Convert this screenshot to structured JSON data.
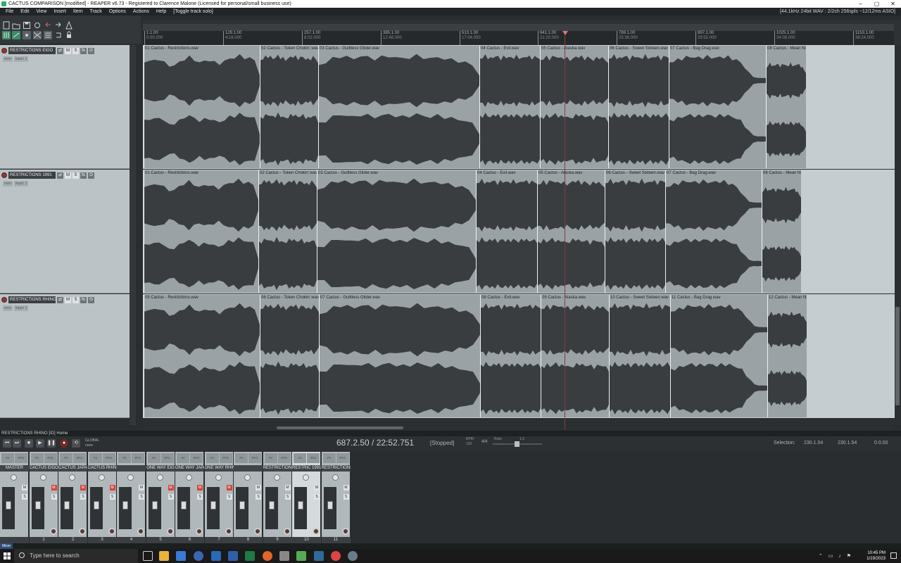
{
  "title_bar": {
    "text": "CACTUS COMPARISON [modified] - REAPER v6.73 - Registered to Clarence Malone (Licensed for personal/small business use)"
  },
  "menu": {
    "items": [
      "File",
      "Edit",
      "View",
      "Insert",
      "Item",
      "Track",
      "Options",
      "Actions",
      "Help",
      "[Toggle track solo]"
    ],
    "status": "[44.1kHz 24bit WAV : 2/2ch 256spls ~12/12ms ASIO]"
  },
  "ruler": {
    "ticks": [
      {
        "bar": "1.1.00",
        "time": "0:00.000"
      },
      {
        "bar": "129.1.00",
        "time": "4:16.000"
      },
      {
        "bar": "257.1.00",
        "time": "8:32.000"
      },
      {
        "bar": "385.1.00",
        "time": "12:48.000"
      },
      {
        "bar": "513.1.00",
        "time": "17:04.000"
      },
      {
        "bar": "641.1.00",
        "time": "21:20.000"
      },
      {
        "bar": "769.1.00",
        "time": "25:36.000"
      },
      {
        "bar": "897.1.00",
        "time": "29:52.000"
      },
      {
        "bar": "1025.1.00",
        "time": "34:08.000"
      },
      {
        "bar": "1153.1.00",
        "time": "38:24.000"
      }
    ]
  },
  "tracks": [
    {
      "name": "RESTRICTIONS EIGO",
      "num": "9",
      "input": "Input: 1",
      "items": [
        {
          "label": "01 Cactus - Restrictions.wav"
        },
        {
          "label": "02 Cactus - Token Chokin'.wav"
        },
        {
          "label": "03 Cactus - Guiltless Glider.wav"
        },
        {
          "label": "04 Cactus - Evil.wav"
        },
        {
          "label": "05 Cactus - Alaska.wav"
        },
        {
          "label": "06 Cactus - Sweet Sixteen.wav"
        },
        {
          "label": "07 Cactus - Bag Drag.wav"
        },
        {
          "label": "08 Cactus - Mean Night..."
        }
      ]
    },
    {
      "name": "RESTRICTIONS 1991",
      "num": "10",
      "input": "Input: 1",
      "items": [
        {
          "label": "01 Cactus - Restrictions.wav"
        },
        {
          "label": "02 Cactus - Token Chokin'.wav"
        },
        {
          "label": "03 Cactus - Guiltless Glider.wav"
        },
        {
          "label": "04 Cactus - Evil.wav"
        },
        {
          "label": "05 Cactus - Alaska.wav"
        },
        {
          "label": "06 Cactus - Sweet Sixteen.wav"
        },
        {
          "label": "07 Cactus - Bag Drag.wav"
        },
        {
          "label": "08 Cactus - Mean Nig..."
        }
      ]
    },
    {
      "name": "RESTRICTIONS RHINO",
      "num": "11",
      "input": "Input: 1",
      "items": [
        {
          "label": "05 Cactus - Restrictions.wav"
        },
        {
          "label": "06 Cactus - Token Chokin'.wav"
        },
        {
          "label": "07 Cactus - Guiltless Glider.wav"
        },
        {
          "label": "08 Cactus - Evil.wav"
        },
        {
          "label": "09 Cactus - Alaska.wav"
        },
        {
          "label": "10 Cactus - Sweet Sixteen.wav"
        },
        {
          "label": "11 Cactus - Bag Drag.wav"
        },
        {
          "label": "12 Cactus - Mean Nigh..."
        }
      ]
    }
  ],
  "track_status": "RESTRICTIONS RHINO [ID] Home",
  "transport": {
    "position": "687.2.50 / 22:52.751",
    "state": "[Stopped]",
    "bpm_label": "BPM",
    "bpm": "120",
    "timesig": "4/4",
    "rate_label": "Rate:",
    "rate": "1.0",
    "selection_label": "Selection:",
    "sel_start": "230.1.54",
    "sel_end": "230.1.54",
    "sel_len": "0.0.00",
    "global": "GLOBAL",
    "global_mode": "none"
  },
  "mixer": {
    "label": "Mixer",
    "strips": [
      {
        "name": "MASTER",
        "num": "",
        "mute": false
      },
      {
        "name": "CACTUS EIGO",
        "num": "1",
        "mute": true
      },
      {
        "name": "CACTUS JAPAN",
        "num": "2",
        "mute": true
      },
      {
        "name": "CACTUS RHINO",
        "num": "3",
        "mute": true
      },
      {
        "name": "",
        "num": "4",
        "mute": false
      },
      {
        "name": "ONE WAY EIG",
        "num": "5",
        "mute": true
      },
      {
        "name": "ONE WAY JAPA",
        "num": "6",
        "mute": true
      },
      {
        "name": "ONE WAY RHIN",
        "num": "7",
        "mute": true
      },
      {
        "name": "",
        "num": "8",
        "mute": false
      },
      {
        "name": "RESTRICTIONS",
        "num": "9",
        "mute": false
      },
      {
        "name": "RESTRIC 1991",
        "num": "10",
        "mute": false
      },
      {
        "name": "RESTRICTIONS",
        "num": "11",
        "mute": false
      }
    ]
  },
  "taskbar": {
    "search_placeholder": "Type here to search",
    "time": "10:45 PM",
    "date": "1/19/2023"
  },
  "colors": {
    "background": "#2a2d30",
    "item": "#9aa2a6",
    "waveform": "#3a3d40",
    "playhead": "#8b3a3a",
    "mute_on": "#d5453c"
  }
}
